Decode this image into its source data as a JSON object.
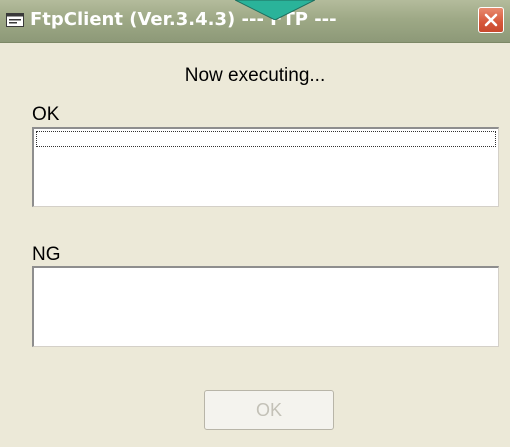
{
  "window": {
    "title": "FtpClient (Ver.3.4.3) --- FTP ---"
  },
  "icons": {
    "app": "app-window-icon",
    "close": "close-icon",
    "pointer": "pointer-arrow-icon"
  },
  "colors": {
    "titlebar": "#9ea986",
    "close_button": "#d6573a",
    "pointer": "#2ab39a",
    "background": "#ece9d8"
  },
  "status_text": "Now executing...",
  "ok_section": {
    "label": "OK",
    "items": []
  },
  "ng_section": {
    "label": "NG",
    "items": []
  },
  "ok_button": {
    "label": "OK",
    "enabled": false
  }
}
